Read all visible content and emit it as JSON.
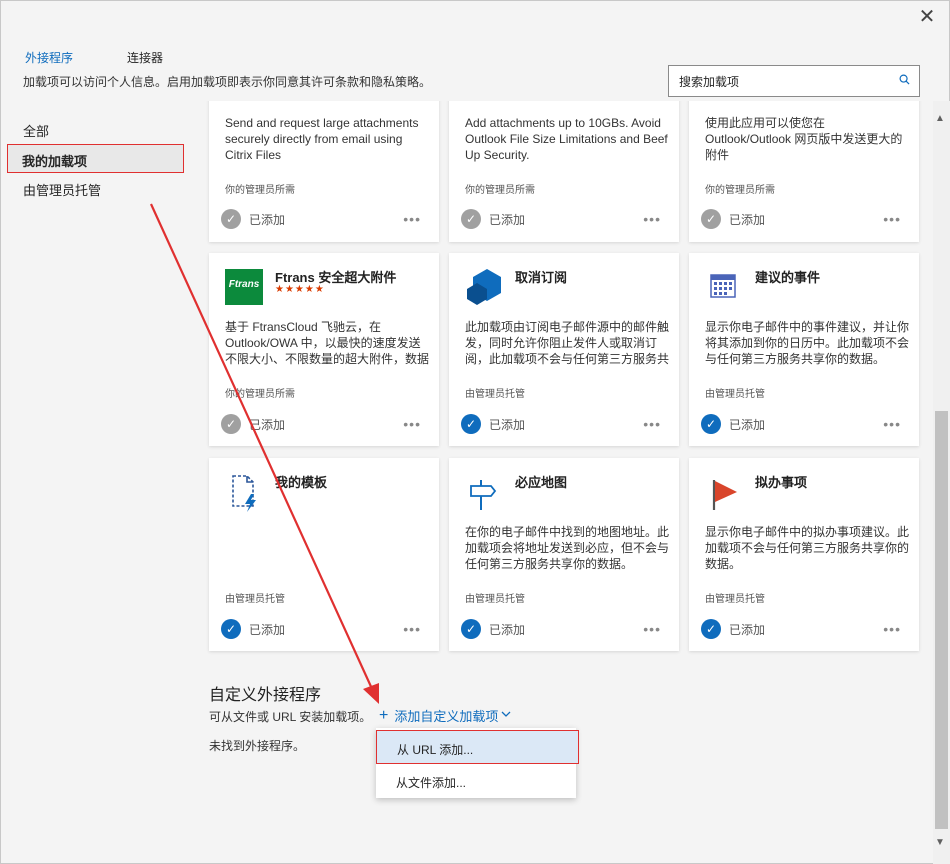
{
  "window": {
    "close_glyph": "✕"
  },
  "tabs": [
    {
      "label": "外接程序",
      "active": true
    },
    {
      "label": "连接器",
      "active": false
    }
  ],
  "consent_text": "加载项可以访问个人信息。启用加载项即表示你同意其许可条款和隐私策略。",
  "search": {
    "placeholder": "搜索加载项",
    "icon": "search-icon"
  },
  "sidebar": {
    "items": [
      {
        "label": "全部"
      },
      {
        "label": "我的加载项",
        "selected": true
      },
      {
        "label": "由管理员托管"
      }
    ]
  },
  "cards": [
    {
      "title": "",
      "desc": "Send and request large attachments securely directly from email using Citrix Files",
      "tag": "你的管理员所需",
      "status": "已添加",
      "check": "grey"
    },
    {
      "title": "",
      "desc": "Add attachments up to 10GBs. Avoid Outlook File Size Limitations and Beef Up Security.",
      "tag": "你的管理员所需",
      "status": "已添加",
      "check": "grey"
    },
    {
      "title": "",
      "desc": "使用此应用可以使您在 Outlook/Outlook 网页版中发送更大的附件",
      "tag": "你的管理员所需",
      "status": "已添加",
      "check": "grey"
    },
    {
      "title": "Ftrans 安全超大附件",
      "stars": "★★★★★",
      "logo_text": "Ftrans",
      "desc": "基于 FtransCloud 飞驰云，在 Outlook/OWA 中，以最快的速度发送不限大小、不限数量的超大附件，数据",
      "tag": "你的管理员所需",
      "status": "已添加",
      "check": "grey"
    },
    {
      "title": "取消订阅",
      "desc": "此加载项由订阅电子邮件源中的邮件触发，同时允许你阻止发件人或取消订阅，此加载项不会与任何第三方服务共",
      "tag": "由管理员托管",
      "status": "已添加",
      "check": "blue"
    },
    {
      "title": "建议的事件",
      "desc": "显示你电子邮件中的事件建议，并让你将其添加到你的日历中。此加载项不会与任何第三方服务共享你的数据。",
      "tag": "由管理员托管",
      "status": "已添加",
      "check": "blue"
    },
    {
      "title": "我的模板",
      "desc": "",
      "tag": "由管理员托管",
      "status": "已添加",
      "check": "blue"
    },
    {
      "title": "必应地图",
      "desc": "在你的电子邮件中找到的地图地址。此加载项会将地址发送到必应，但不会与任何第三方服务共享你的数据。",
      "tag": "由管理员托管",
      "status": "已添加",
      "check": "blue"
    },
    {
      "title": "拟办事项",
      "desc": "显示你电子邮件中的拟办事项建议。此加载项不会与任何第三方服务共享你的数据。",
      "tag": "由管理员托管",
      "status": "已添加",
      "check": "blue"
    }
  ],
  "more_glyph": "•••",
  "custom": {
    "title": "自定义外接程序",
    "text": "可从文件或 URL 安装加载项。",
    "add_label": "添加自定义加载项",
    "none_text": "未找到外接程序。"
  },
  "dropdown": {
    "items": [
      {
        "label": "从 URL 添加...",
        "highlighted": true
      },
      {
        "label": "从文件添加..."
      }
    ]
  },
  "colors": {
    "accent": "#0f6cbd",
    "annotation": "#e03030",
    "check_grey": "#a0a0a0"
  }
}
